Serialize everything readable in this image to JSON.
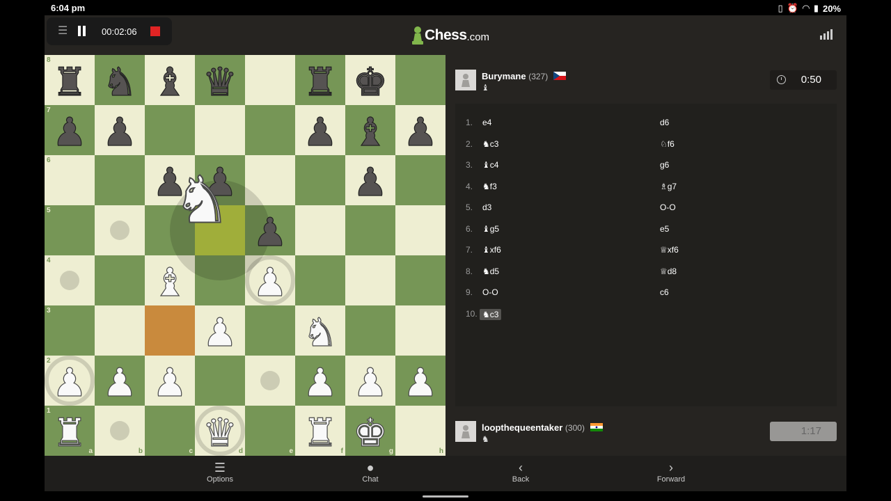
{
  "status": {
    "time": "6:04 pm",
    "battery": "20%"
  },
  "recorder": {
    "elapsed": "00:02:06"
  },
  "logo": {
    "name": "Chess",
    "domain": ".com"
  },
  "top_player": {
    "name": "Burymane",
    "rating": "(327)",
    "captured": "♝",
    "clock": "0:50"
  },
  "bottom_player": {
    "name": "loopthequeentaker",
    "rating": "(300)",
    "captured": "♞",
    "clock": "1:17"
  },
  "files": [
    "a",
    "b",
    "c",
    "d",
    "e",
    "f",
    "g",
    "h"
  ],
  "ranks": [
    "8",
    "7",
    "6",
    "5",
    "4",
    "3",
    "2",
    "1"
  ],
  "pieces": [
    {
      "sq": "a8",
      "p": "♜",
      "c": "b"
    },
    {
      "sq": "b8",
      "p": "♞",
      "c": "b"
    },
    {
      "sq": "c8",
      "p": "♝",
      "c": "b"
    },
    {
      "sq": "d8",
      "p": "♛",
      "c": "b"
    },
    {
      "sq": "f8",
      "p": "♜",
      "c": "b"
    },
    {
      "sq": "g8",
      "p": "♚",
      "c": "b"
    },
    {
      "sq": "a7",
      "p": "♟",
      "c": "b"
    },
    {
      "sq": "b7",
      "p": "♟",
      "c": "b"
    },
    {
      "sq": "f7",
      "p": "♟",
      "c": "b"
    },
    {
      "sq": "g7",
      "p": "♝",
      "c": "b"
    },
    {
      "sq": "h7",
      "p": "♟",
      "c": "b"
    },
    {
      "sq": "c6",
      "p": "♟",
      "c": "b"
    },
    {
      "sq": "d6",
      "p": "♟",
      "c": "b"
    },
    {
      "sq": "g6",
      "p": "♟",
      "c": "b"
    },
    {
      "sq": "e5",
      "p": "♟",
      "c": "b"
    },
    {
      "sq": "c4",
      "p": "♝",
      "c": "w"
    },
    {
      "sq": "e4",
      "p": "♟",
      "c": "w"
    },
    {
      "sq": "d3",
      "p": "♟",
      "c": "w"
    },
    {
      "sq": "f3",
      "p": "♞",
      "c": "w"
    },
    {
      "sq": "a2",
      "p": "♟",
      "c": "w"
    },
    {
      "sq": "b2",
      "p": "♟",
      "c": "w"
    },
    {
      "sq": "c2",
      "p": "♟",
      "c": "w"
    },
    {
      "sq": "f2",
      "p": "♟",
      "c": "w"
    },
    {
      "sq": "g2",
      "p": "♟",
      "c": "w"
    },
    {
      "sq": "h2",
      "p": "♟",
      "c": "w"
    },
    {
      "sq": "a1",
      "p": "♜",
      "c": "w"
    },
    {
      "sq": "d1",
      "p": "♛",
      "c": "w"
    },
    {
      "sq": "f1",
      "p": "♜",
      "c": "w"
    },
    {
      "sq": "g1",
      "p": "♚",
      "c": "w"
    }
  ],
  "dragged_piece": {
    "p": "♞",
    "c": "w",
    "over": "d5"
  },
  "last_move_from": "c3",
  "legal_dots": [
    "b5",
    "a4",
    "e2",
    "b1"
  ],
  "legal_rings": [
    "e4",
    "a2",
    "d1"
  ],
  "moves": [
    {
      "n": "1.",
      "w": "e4",
      "b": "d6"
    },
    {
      "n": "2.",
      "w": "♞c3",
      "b": "♘f6"
    },
    {
      "n": "3.",
      "w": "♝c4",
      "b": "g6"
    },
    {
      "n": "4.",
      "w": "♞f3",
      "b": "♗g7"
    },
    {
      "n": "5.",
      "w": "d3",
      "b": "O-O"
    },
    {
      "n": "6.",
      "w": "♝g5",
      "b": "e5"
    },
    {
      "n": "7.",
      "w": "♝xf6",
      "b": "♕xf6"
    },
    {
      "n": "8.",
      "w": "♞d5",
      "b": "♕d8"
    },
    {
      "n": "9.",
      "w": "O-O",
      "b": "c6"
    },
    {
      "n": "10.",
      "w": "♞c3",
      "b": ""
    }
  ],
  "nav": {
    "options": "Options",
    "chat": "Chat",
    "back": "Back",
    "forward": "Forward"
  }
}
